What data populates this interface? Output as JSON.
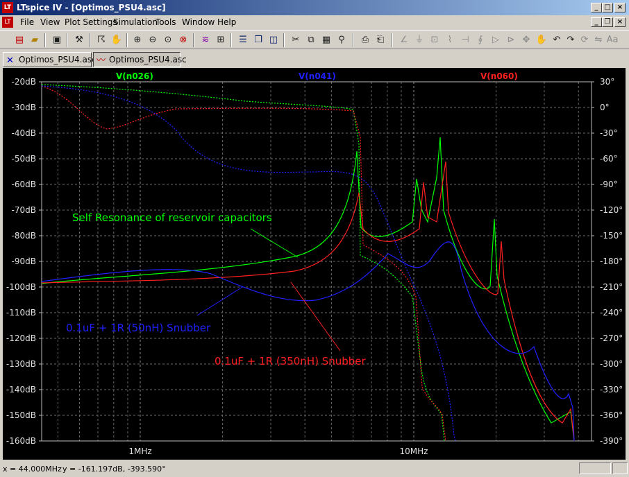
{
  "window": {
    "title": "LTspice IV - [Optimos_PSU4.asc]",
    "icon_label": "LT",
    "controls": [
      "_",
      "□",
      "×"
    ]
  },
  "menu": [
    "File",
    "View",
    "Plot Settings",
    "Simulation",
    "Tools",
    "Window",
    "Help"
  ],
  "child_controls": [
    "_",
    "❐",
    "×"
  ],
  "toolbar": {
    "icons": [
      "new-schematic-icon",
      "open-icon",
      "save-icon",
      "control-panel-icon",
      "run-icon",
      "halt-icon",
      "zoom-in-icon",
      "zoom-out-icon",
      "zoom-fit-icon",
      "zoom-cancel-icon",
      "autorange-icon",
      "grid-icon",
      "tile-horizontal-icon",
      "cascade-icon",
      "tile-vertical-icon",
      "cut-icon",
      "copy-icon",
      "paste-icon",
      "find-icon",
      "print-setup-icon",
      "print-icon",
      "wire-icon",
      "ground-icon",
      "label-icon",
      "resistor-icon",
      "capacitor-icon",
      "inductor-icon",
      "diode-icon",
      "component-icon",
      "move-icon",
      "drag-icon",
      "undo-icon",
      "redo-icon",
      "rotate-icon",
      "mirror-icon",
      "text-icon",
      "spice-directive-icon"
    ]
  },
  "tabs": [
    {
      "label": "Optimos_PSU4.asc",
      "icon": "schematic-icon",
      "active": false
    },
    {
      "label": "Optimos_PSU4.asc",
      "icon": "waveform-icon",
      "active": true
    }
  ],
  "plot": {
    "traces": [
      {
        "label": "V(n026)",
        "color": "#00ff00"
      },
      {
        "label": "V(n041)",
        "color": "#2020ff"
      },
      {
        "label": "V(n060)",
        "color": "#ff2020"
      }
    ],
    "left_ticks": [
      "-20dB",
      "-30dB",
      "-40dB",
      "-50dB",
      "-60dB",
      "-70dB",
      "-80dB",
      "-90dB",
      "-100dB",
      "-110dB",
      "-120dB",
      "-130dB",
      "-140dB",
      "-150dB",
      "-160dB"
    ],
    "right_ticks": [
      "30°",
      "0°",
      "-30°",
      "-60°",
      "-90°",
      "-120°",
      "-150°",
      "-180°",
      "-210°",
      "-240°",
      "-270°",
      "-300°",
      "-330°",
      "-360°",
      "-390°"
    ],
    "x_ticks": [
      {
        "label": "1MHz",
        "value": 1
      },
      {
        "label": "10MHz",
        "value": 10
      }
    ],
    "annotations": [
      {
        "text": "Self Resonance of reservoir capacitors",
        "color": "#00ff00"
      },
      {
        "text": "0.1uF + 1R (50nH) Snubber",
        "color": "#2020ff"
      },
      {
        "text": "0.1uF + 1R (350nH) Snubber",
        "color": "#ff2020"
      }
    ],
    "grid_color": "#6b6b6b"
  },
  "status": {
    "x_readout": "x = 44.000MHz",
    "y_readout": "y = -161.197dB, -393.590°"
  }
}
